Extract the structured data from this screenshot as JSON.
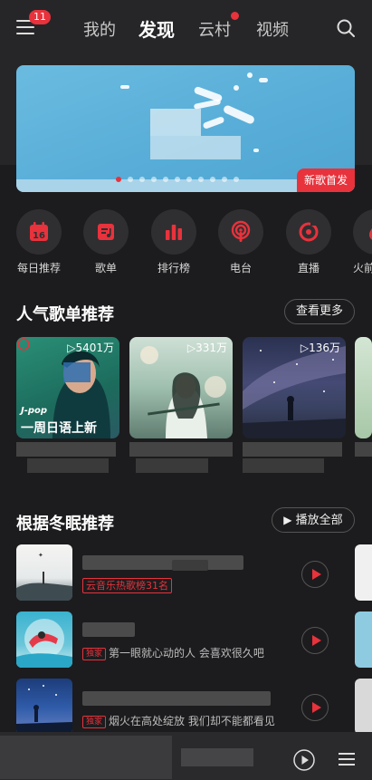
{
  "header": {
    "menu_badge": "11",
    "tabs": [
      {
        "label": "我的",
        "active": false
      },
      {
        "label": "发现",
        "active": true
      },
      {
        "label": "云村",
        "active": false,
        "dot": true
      },
      {
        "label": "视频",
        "active": false
      }
    ]
  },
  "banner": {
    "tag": "新歌首发",
    "slide_count": 11,
    "active_slide": 0
  },
  "quick_icons": [
    {
      "label": "每日推荐",
      "icon": "calendar-icon",
      "day": "16"
    },
    {
      "label": "歌单",
      "icon": "playlist-icon"
    },
    {
      "label": "排行榜",
      "icon": "chart-bars-icon"
    },
    {
      "label": "电台",
      "icon": "radio-icon"
    },
    {
      "label": "直播",
      "icon": "live-icon"
    },
    {
      "label": "火前",
      "icon": "fire-icon"
    }
  ],
  "popular": {
    "title": "人气歌单推荐",
    "more": "查看更多",
    "items": [
      {
        "count": "▷5401万",
        "cover_text_1": "J-pop",
        "cover_text_2": "一周日语上新"
      },
      {
        "count": "▷331万"
      },
      {
        "count": "▷136万"
      }
    ]
  },
  "recommend": {
    "title": "根据冬眠推荐",
    "play_all": "播放全部",
    "songs": [
      {
        "tag": "云音乐热歌榜31名",
        "sub": ""
      },
      {
        "tag": "独家",
        "sub": "第一眼就心动的人 会喜欢很久吧"
      },
      {
        "tag": "独家",
        "sub": "烟火在高处绽放 我们却不能都看见"
      }
    ]
  },
  "colors": {
    "accent": "#e8323c",
    "bg": "#1c1c1e"
  }
}
